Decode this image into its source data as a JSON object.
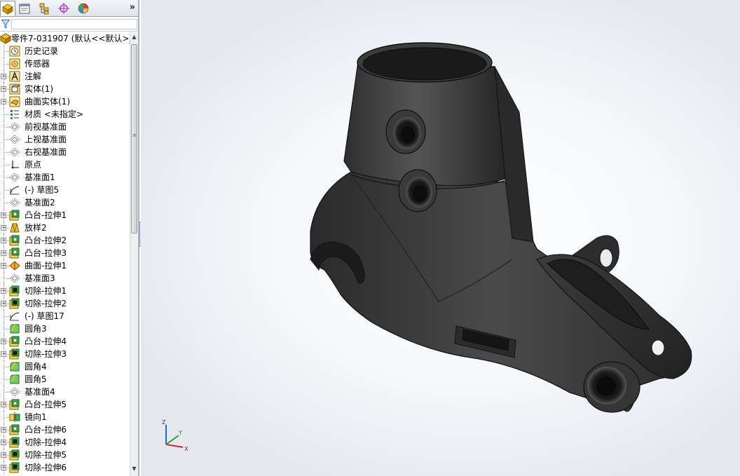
{
  "feature_manager": {
    "tabs": [
      {
        "name": "feature-manager-tab",
        "icon": "feature-tree-icon"
      },
      {
        "name": "property-manager-tab",
        "icon": "property-manager-icon"
      },
      {
        "name": "configuration-manager-tab",
        "icon": "configuration-manager-icon"
      },
      {
        "name": "dimxpert-manager-tab",
        "icon": "dimxpert-icon"
      },
      {
        "name": "display-manager-tab",
        "icon": "display-manager-icon"
      }
    ],
    "more_label": "»",
    "filter_icon": "filter-icon",
    "root_label": "零件7-031907  (默认<<默认>_",
    "items": [
      {
        "label": "历史记录",
        "icon": "history-icon",
        "expandable": false
      },
      {
        "label": "传感器",
        "icon": "sensor-icon",
        "expandable": false
      },
      {
        "label": "注解",
        "icon": "annotation-icon",
        "expandable": true
      },
      {
        "label": "实体(1)",
        "icon": "solid-bodies-icon",
        "expandable": true
      },
      {
        "label": "曲面实体(1)",
        "icon": "surface-bodies-icon",
        "expandable": true
      },
      {
        "label": "材质 <未指定>",
        "icon": "material-icon",
        "expandable": false
      },
      {
        "label": "前视基准面",
        "icon": "plane-icon",
        "expandable": false
      },
      {
        "label": "上视基准面",
        "icon": "plane-icon",
        "expandable": false
      },
      {
        "label": "右视基准面",
        "icon": "plane-icon",
        "expandable": false
      },
      {
        "label": "原点",
        "icon": "origin-icon",
        "expandable": false
      },
      {
        "label": "基准面1",
        "icon": "plane-icon",
        "expandable": false
      },
      {
        "label": "(-) 草图5",
        "icon": "sketch-icon",
        "expandable": false
      },
      {
        "label": "基准面2",
        "icon": "plane-icon",
        "expandable": false
      },
      {
        "label": "凸台-拉伸1",
        "icon": "boss-extrude-icon",
        "expandable": true
      },
      {
        "label": "放样2",
        "icon": "loft-icon",
        "expandable": true
      },
      {
        "label": "凸台-拉伸2",
        "icon": "boss-extrude-icon",
        "expandable": true
      },
      {
        "label": "凸台-拉伸3",
        "icon": "boss-extrude-icon",
        "expandable": true
      },
      {
        "label": "曲面-拉伸1",
        "icon": "surface-extrude-icon",
        "expandable": true
      },
      {
        "label": "基准面3",
        "icon": "plane-icon",
        "expandable": false
      },
      {
        "label": "切除-拉伸1",
        "icon": "cut-extrude-icon",
        "expandable": true
      },
      {
        "label": "切除-拉伸2",
        "icon": "cut-extrude-icon",
        "expandable": true
      },
      {
        "label": "(-) 草图17",
        "icon": "sketch-icon",
        "expandable": false
      },
      {
        "label": "圆角3",
        "icon": "fillet-icon",
        "expandable": false
      },
      {
        "label": "凸台-拉伸4",
        "icon": "boss-extrude-icon",
        "expandable": true
      },
      {
        "label": "切除-拉伸3",
        "icon": "cut-extrude-icon",
        "expandable": true
      },
      {
        "label": "圆角4",
        "icon": "fillet-icon",
        "expandable": false
      },
      {
        "label": "圆角5",
        "icon": "fillet-icon",
        "expandable": false
      },
      {
        "label": "基准面4",
        "icon": "plane-icon",
        "expandable": false
      },
      {
        "label": "凸台-拉伸5",
        "icon": "boss-extrude-icon",
        "expandable": true
      },
      {
        "label": "镜向1",
        "icon": "mirror-icon",
        "expandable": false
      },
      {
        "label": "凸台-拉伸6",
        "icon": "boss-extrude-icon",
        "expandable": true
      },
      {
        "label": "切除-拉伸4",
        "icon": "cut-extrude-icon",
        "expandable": true
      },
      {
        "label": "切除-拉伸5",
        "icon": "cut-extrude-icon",
        "expandable": true
      },
      {
        "label": "切除-拉伸6",
        "icon": "cut-extrude-icon",
        "expandable": true
      }
    ]
  },
  "viewport": {
    "triad": {
      "x_label": "X",
      "y_label": "Y",
      "z_label": "Z"
    },
    "model_color": "#3a3a3a"
  }
}
